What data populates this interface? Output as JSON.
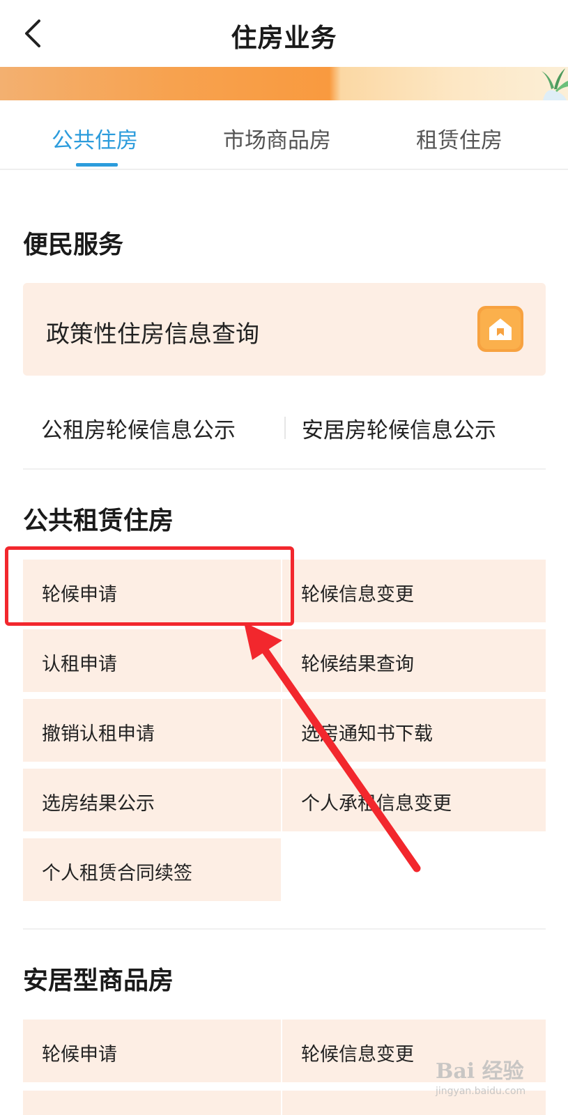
{
  "header": {
    "title": "住房业务",
    "back_icon": "chevron-left-icon"
  },
  "tabs": [
    {
      "label": "公共住房",
      "active": true
    },
    {
      "label": "市场商品房",
      "active": false
    },
    {
      "label": "租赁住房",
      "active": false
    }
  ],
  "convenience": {
    "title": "便民服务",
    "card": {
      "label": "政策性住房信息查询",
      "icon": "house-icon"
    },
    "links": [
      "公租房轮候信息公示",
      "安居房轮候信息公示"
    ]
  },
  "public_rental": {
    "title": "公共租赁住房",
    "items": [
      "轮候申请",
      "轮候信息变更",
      "认租申请",
      "轮候结果查询",
      "撤销认租申请",
      "选房通知书下载",
      "选房结果公示",
      "个人承租信息变更",
      "个人租赁合同续签"
    ]
  },
  "anju": {
    "title": "安居型商品房",
    "items": [
      "轮候申请",
      "轮候信息变更"
    ]
  },
  "watermark": {
    "brand": "Bai 经验",
    "sub": "jingyan.baidu.com"
  },
  "colors": {
    "accent": "#2c9cdc",
    "tile_bg": "#fdeee4",
    "annotation": "#f2272d",
    "icon_orange": "#f7a240"
  }
}
